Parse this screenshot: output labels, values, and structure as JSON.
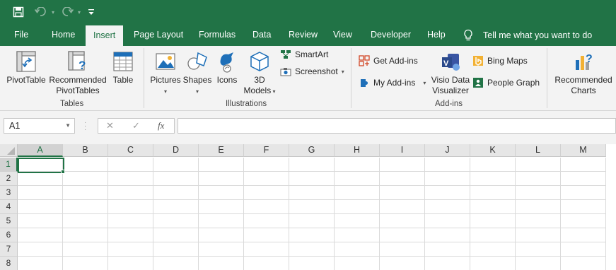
{
  "colors": {
    "brand": "#217346",
    "ribbon_bg": "#f3f3f3",
    "header_bg": "#e6e6e6"
  },
  "qat": {
    "save_icon": "save-icon",
    "undo_icon": "undo-icon",
    "redo_icon": "redo-icon",
    "customize_icon": "customize-qat-icon"
  },
  "tabs": [
    {
      "label": "File"
    },
    {
      "label": "Home"
    },
    {
      "label": "Insert",
      "active": true
    },
    {
      "label": "Page Layout"
    },
    {
      "label": "Formulas"
    },
    {
      "label": "Data"
    },
    {
      "label": "Review"
    },
    {
      "label": "View"
    },
    {
      "label": "Developer"
    },
    {
      "label": "Help"
    }
  ],
  "tell_me": "Tell me what you want to do",
  "ribbon": {
    "tables": {
      "label": "Tables",
      "pivottable": "PivotTable",
      "recommended_line1": "Recommended",
      "recommended_line2": "PivotTables",
      "table": "Table"
    },
    "illustrations": {
      "label": "Illustrations",
      "pictures": "Pictures",
      "shapes": "Shapes",
      "icons": "Icons",
      "models_line1": "3D",
      "models_line2": "Models",
      "smartart": "SmartArt",
      "screenshot": "Screenshot"
    },
    "addins": {
      "label": "Add-ins",
      "get_addins": "Get Add-ins",
      "my_addins": "My Add-ins",
      "visio_line1": "Visio Data",
      "visio_line2": "Visualizer",
      "bing_maps": "Bing Maps",
      "people_graph": "People Graph"
    },
    "charts": {
      "recommended_line1": "Recommended",
      "recommended_line2": "Charts"
    }
  },
  "formula_bar": {
    "name_box": "A1",
    "cancel_glyph": "✕",
    "enter_glyph": "✓",
    "fx_label": "fx",
    "formula_value": ""
  },
  "grid": {
    "columns": [
      "A",
      "B",
      "C",
      "D",
      "E",
      "F",
      "G",
      "H",
      "I",
      "J",
      "K",
      "L",
      "M"
    ],
    "rows": [
      "1",
      "2",
      "3",
      "4",
      "5",
      "6",
      "7",
      "8"
    ],
    "selected_column": "A",
    "selected_row": "1"
  }
}
